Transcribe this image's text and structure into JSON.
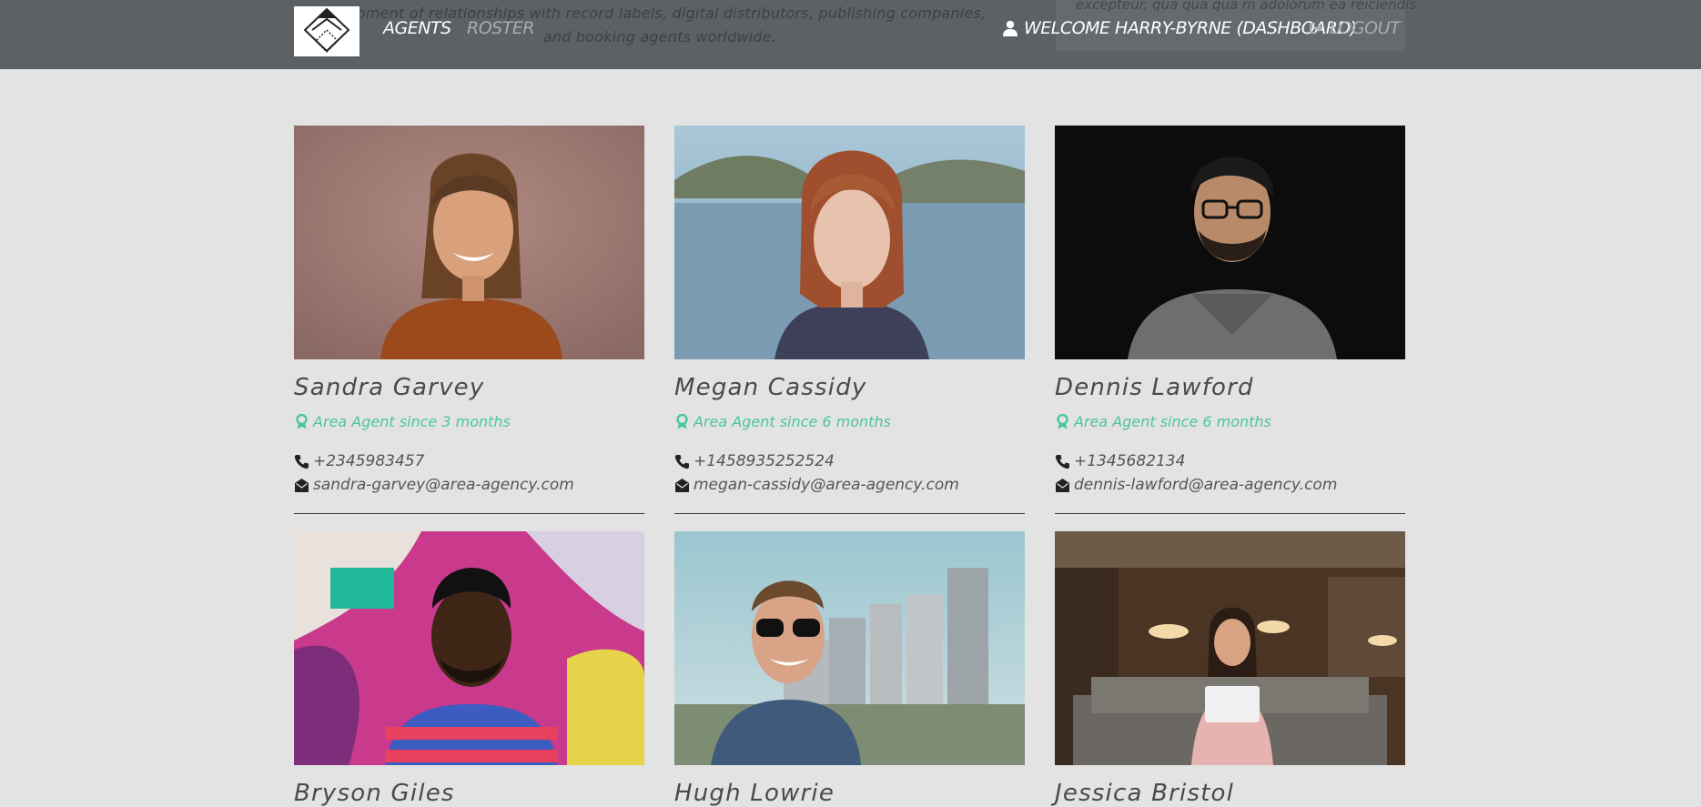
{
  "navbar": {
    "background_text": "elopment of relationships with record labels, digital distributors, publishing companies, and booking agents worldwide.",
    "background_box_text": "excepteur, qua qua qua m adolorum ea reiciendis",
    "logo_icon": "diamond-logo-icon",
    "links": {
      "agents": "AGENTS",
      "roster": "ROSTER"
    },
    "welcome": {
      "icon": "user-icon",
      "label": "WELCOME HARRY-BYRNE (DASHBOARD)"
    },
    "logout": {
      "icon": "sign-out-icon",
      "label": "LOGOUT"
    }
  },
  "colors": {
    "navbar_bg": "#5b6164",
    "page_bg": "#e3e3e3",
    "accent_green": "#4cc5a0",
    "text_dark": "#4a4a4a"
  },
  "agents": [
    {
      "name": "Sandra Garvey",
      "since": "Area Agent since 3 months",
      "phone": "+2345983457",
      "email": "sandra-garvey@area-agency.com"
    },
    {
      "name": "Megan Cassidy",
      "since": "Area Agent since 6 months",
      "phone": "+1458935252524",
      "email": "megan-cassidy@area-agency.com"
    },
    {
      "name": "Dennis Lawford",
      "since": "Area Agent since 6 months",
      "phone": "+1345682134",
      "email": "dennis-lawford@area-agency.com"
    },
    {
      "name": "Bryson Giles",
      "since": "",
      "phone": "",
      "email": ""
    },
    {
      "name": "Hugh Lowrie",
      "since": "",
      "phone": "",
      "email": ""
    },
    {
      "name": "Jessica Bristol",
      "since": "",
      "phone": "",
      "email": ""
    }
  ],
  "icons": {
    "award": "award-icon",
    "phone": "phone-icon",
    "email": "envelope-icon"
  }
}
